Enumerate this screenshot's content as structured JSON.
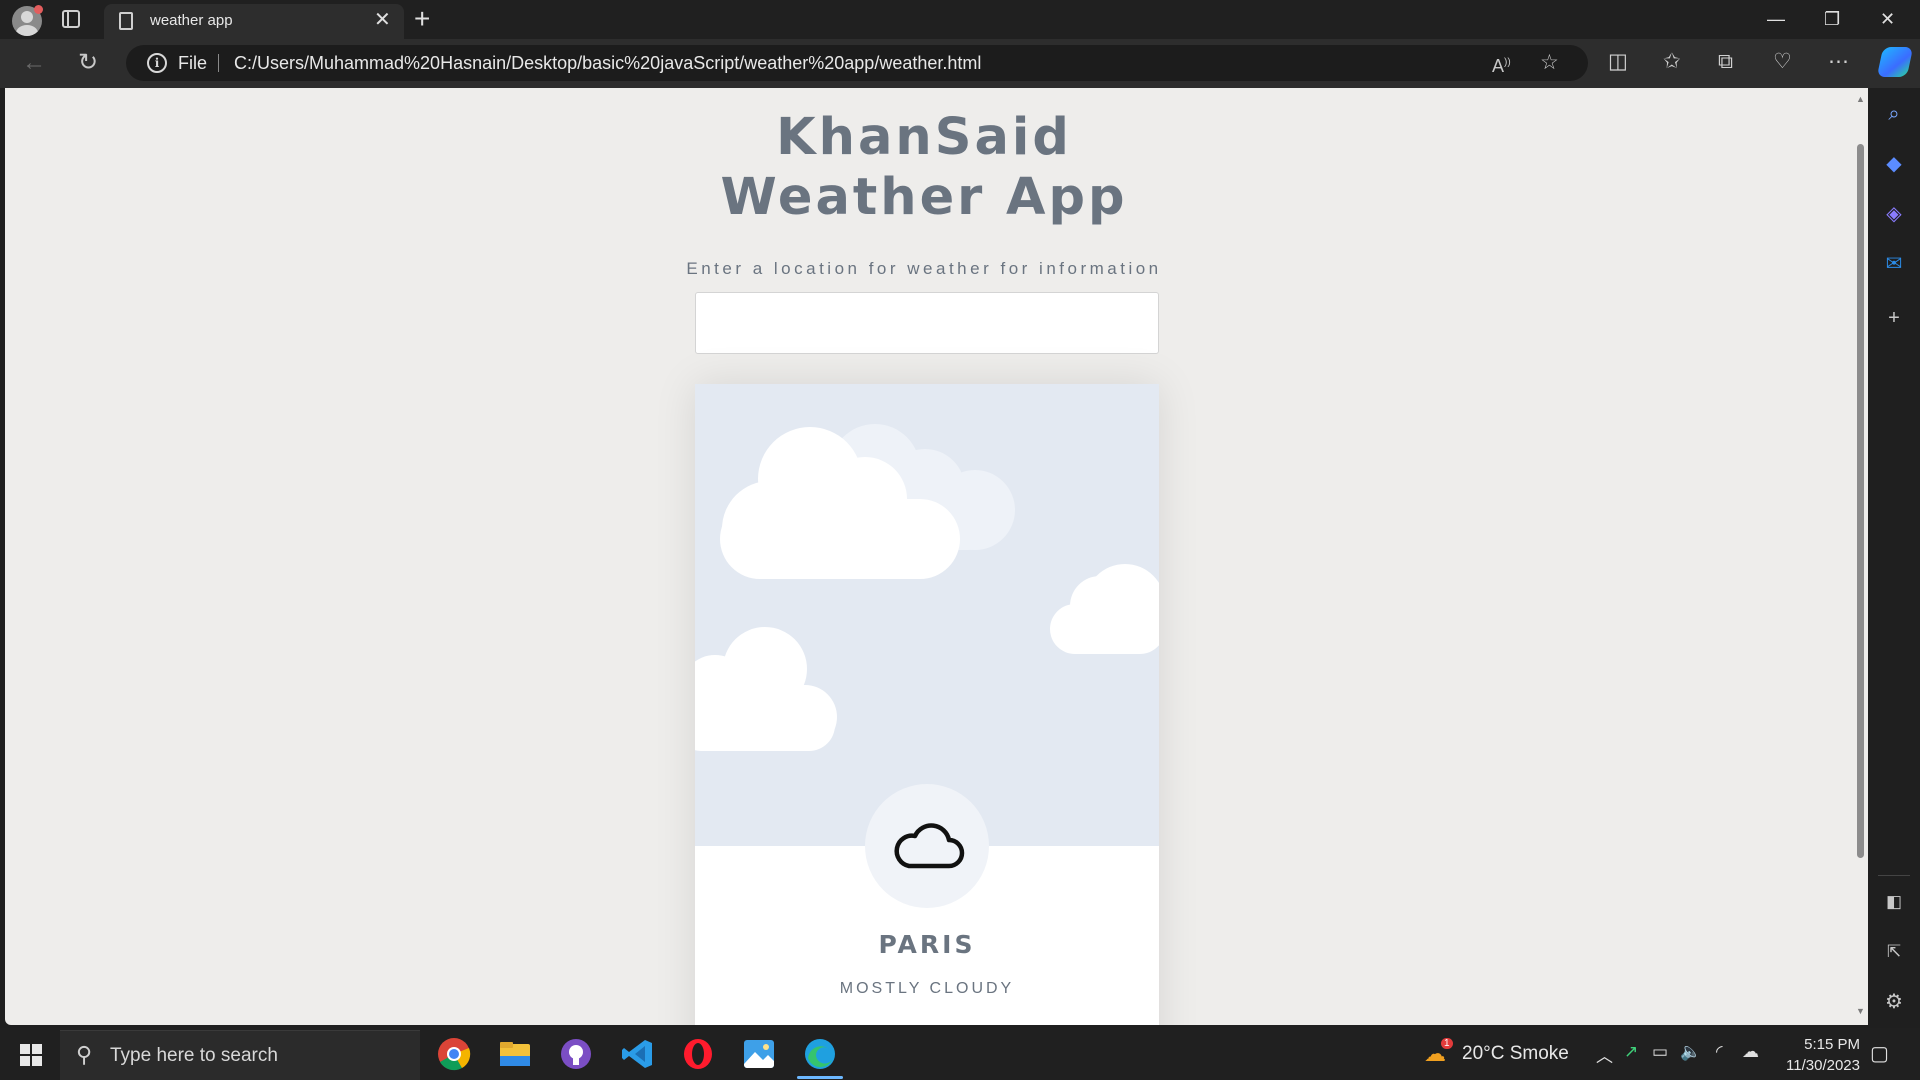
{
  "browser": {
    "tab_title": "weather app",
    "tab_close": "✕",
    "new_tab": "+",
    "window_controls": {
      "minimize": "—",
      "restore": "❐",
      "close": "✕"
    },
    "address": {
      "scheme_label": "File",
      "url": "C:/Users/Muhammad%20Hasnain/Desktop/basic%20javaScript/weather%20app/weather.html"
    }
  },
  "page": {
    "title_line1": "KhanSaid",
    "title_line2": "Weather App",
    "subtitle": "Enter a location for weather for information",
    "search": {
      "value": "",
      "placeholder": ""
    },
    "card": {
      "city": "PARIS",
      "condition": "MOSTLY CLOUDY",
      "icon": "cloud-icon",
      "sky_color": "#e3e9f2"
    }
  },
  "taskbar": {
    "search_placeholder": "Type here to search",
    "apps": [
      "chrome-icon",
      "file-explorer-icon",
      "github-desktop-icon",
      "vscode-icon",
      "opera-icon",
      "photos-icon",
      "edge-icon"
    ],
    "weather": {
      "text": "20°C  Smoke",
      "alert_count": "1"
    },
    "time": "5:15 PM",
    "date": "11/30/2023"
  },
  "colors": {
    "text_primary": "#6a7480",
    "page_background": "#eeedeb",
    "browser_chrome": "#202020"
  }
}
